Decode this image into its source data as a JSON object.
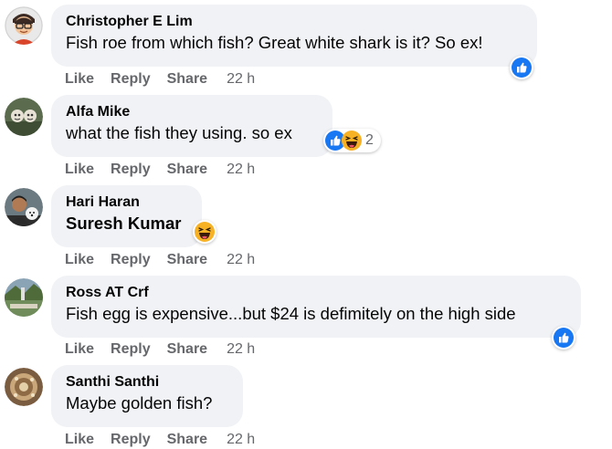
{
  "actions": {
    "like": "Like",
    "reply": "Reply",
    "share": "Share"
  },
  "comments": [
    {
      "author": "Christopher E Lim",
      "text": "Fish roe from which fish? Great white shark is it? So ex!",
      "time": "22 h",
      "reactions": [
        "like-reaction-icon"
      ]
    },
    {
      "author": "Alfa Mike",
      "text": "what the fish they using. so ex",
      "time": "22 h",
      "reactions": [
        "like-reaction-icon",
        "haha-reaction-icon"
      ],
      "reaction_count": "2"
    },
    {
      "author": "Hari Haran",
      "tagged_name": "Suresh Kumar",
      "time": "22 h",
      "reactions": [
        "haha-reaction-icon"
      ]
    },
    {
      "author": "Ross AT Crf",
      "text": "Fish egg is expensive...but $24 is defimitely on the high side",
      "time": "22 h",
      "reactions": [
        "like-reaction-icon"
      ]
    },
    {
      "author": "Santhi Santhi",
      "text": "Maybe golden fish?",
      "time": "22 h"
    }
  ],
  "colors": {
    "bubble": "#f0f2f5",
    "meta_text": "#65676b",
    "like_blue": "#1877f2",
    "haha_yellow": "#f7b125"
  }
}
